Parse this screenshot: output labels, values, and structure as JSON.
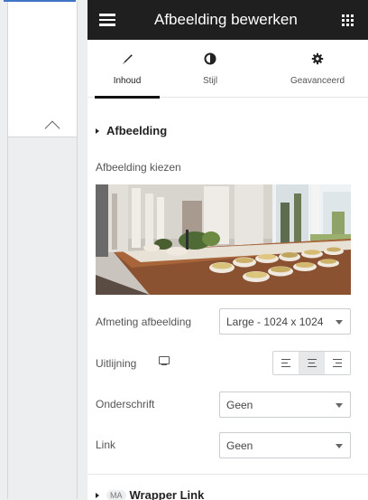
{
  "header": {
    "title": "Afbeelding bewerken",
    "menu_icon": "hamburger-icon",
    "apps_icon": "grid-icon"
  },
  "tabs": [
    {
      "label": "Inhoud",
      "icon": "pencil-icon",
      "active": true
    },
    {
      "label": "Stijl",
      "icon": "half-circle-icon",
      "active": false
    },
    {
      "label": "Geavanceerd",
      "icon": "gear-icon",
      "active": false
    }
  ],
  "section": {
    "title": "Afbeelding"
  },
  "image_picker": {
    "label": "Afbeelding kiezen"
  },
  "image_size": {
    "label": "Afmeting afbeelding",
    "value": "Large - 1024 x 1024"
  },
  "alignment": {
    "label": "Uitlijning",
    "options": [
      "left",
      "center",
      "right"
    ],
    "selected": "center"
  },
  "caption": {
    "label": "Onderschrift",
    "value": "Geen"
  },
  "link": {
    "label": "Link",
    "value": "Geen"
  },
  "wrapper_section": {
    "badge": "MA",
    "title": "Wrapper Link"
  },
  "colors": {
    "header_bg": "#1f1f1f",
    "accent_line": "#3f74c6"
  }
}
